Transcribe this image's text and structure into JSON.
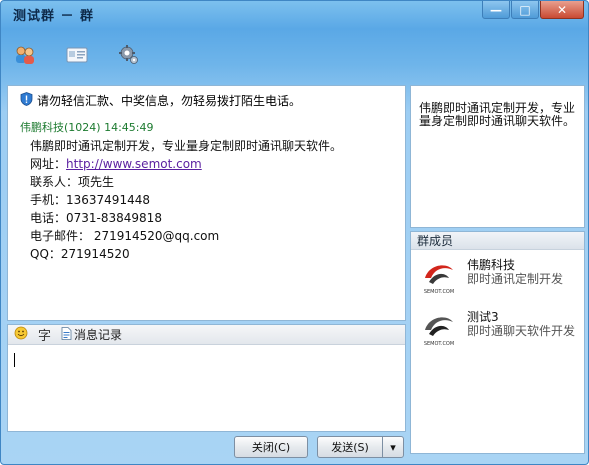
{
  "window": {
    "title": "测试群 － 群",
    "minimize_glyph": "—",
    "maximize_glyph": "□",
    "close_glyph": "✕"
  },
  "toolbar": {
    "icons": [
      "group-members-icon",
      "business-card-icon",
      "settings-gear-icon"
    ]
  },
  "chat": {
    "system_notice": "请勿轻信汇款、中奖信息，勿轻易拨打陌生电话。",
    "message": {
      "sender": "伟鹏科技",
      "sender_id": "(1024)",
      "time": "14:45:49",
      "lines": {
        "l1": "伟鹏即时通讯定制开发，专业量身定制即时通讯聊天软件。",
        "l2_label": "网址：",
        "l2_link": "http://www.semot.com",
        "l3": "联系人：项先生",
        "l4": "手机：13637491448",
        "l5": "电话：0731-83849818",
        "l6": "电子邮件： 271914520@qq.com",
        "l7": "QQ：271914520"
      }
    }
  },
  "notice": {
    "text": "伟鹏即时通讯定制开发，专业量身定制即时通讯聊天软件。"
  },
  "members": {
    "header": "群成员",
    "list": [
      {
        "name": "伟鹏科技",
        "desc": "即时通讯定制开发",
        "logo_text": "SEMOT.COM"
      },
      {
        "name": "测试3",
        "desc": "即时通聊天软件开发",
        "logo_text": "SEMOT.COM"
      }
    ]
  },
  "input": {
    "font_label": "字",
    "history_label": "消息记录",
    "value": ""
  },
  "buttons": {
    "close_label": "关闭(C)",
    "send_label": "发送(S)",
    "send_arrow": "▾"
  },
  "colors": {
    "accent": "#5aa8e6",
    "sender": "#1c7a2f",
    "link": "#5a1fa0",
    "close_button": "#c94a33"
  }
}
